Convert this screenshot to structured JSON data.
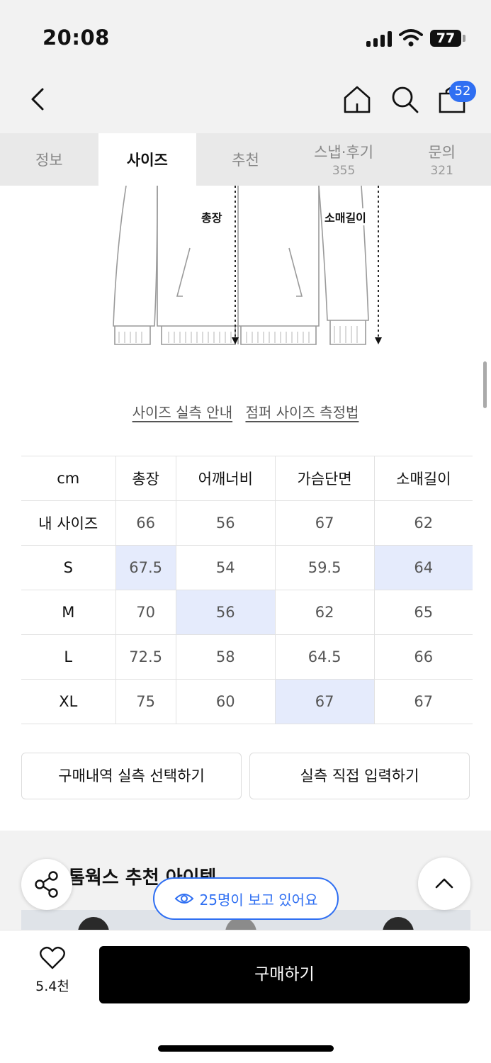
{
  "status": {
    "time": "20:08",
    "battery": "77"
  },
  "header": {
    "cart_count": "52"
  },
  "tabs": [
    {
      "label": "정보",
      "count": ""
    },
    {
      "label": "사이즈",
      "count": ""
    },
    {
      "label": "추천",
      "count": ""
    },
    {
      "label": "스냅·후기",
      "count": "355"
    },
    {
      "label": "문의",
      "count": "321"
    }
  ],
  "diagram": {
    "label_length": "총장",
    "label_sleeve": "소매길이"
  },
  "links": {
    "guide": "사이즈 실측 안내",
    "measure": "점퍼 사이즈 측정법"
  },
  "size_table": {
    "columns": [
      "cm",
      "총장",
      "어깨너비",
      "가슴단면",
      "소매길이"
    ],
    "rows": [
      {
        "label": "내 사이즈",
        "values": [
          "66",
          "56",
          "67",
          "62"
        ],
        "highlight": [
          false,
          false,
          false,
          false
        ]
      },
      {
        "label": "S",
        "values": [
          "67.5",
          "54",
          "59.5",
          "64"
        ],
        "highlight": [
          true,
          false,
          false,
          true
        ]
      },
      {
        "label": "M",
        "values": [
          "70",
          "56",
          "62",
          "65"
        ],
        "highlight": [
          false,
          true,
          false,
          false
        ]
      },
      {
        "label": "L",
        "values": [
          "72.5",
          "58",
          "64.5",
          "66"
        ],
        "highlight": [
          false,
          false,
          false,
          false
        ]
      },
      {
        "label": "XL",
        "values": [
          "75",
          "60",
          "67",
          "67"
        ],
        "highlight": [
          false,
          false,
          true,
          false
        ]
      }
    ]
  },
  "buttons": {
    "purchase_history": "구매내역 실측 선택하기",
    "manual_input": "실측 직접 입력하기"
  },
  "recommend": {
    "title": "톰웍스 추천 아이템"
  },
  "viewers": {
    "text": "25명이 보고 있어요"
  },
  "bottom": {
    "like_count": "5.4천",
    "buy_label": "구매하기"
  },
  "colors": {
    "accent": "#2f6ff2",
    "highlight": "#e5ebfc",
    "buy": "#000000"
  }
}
